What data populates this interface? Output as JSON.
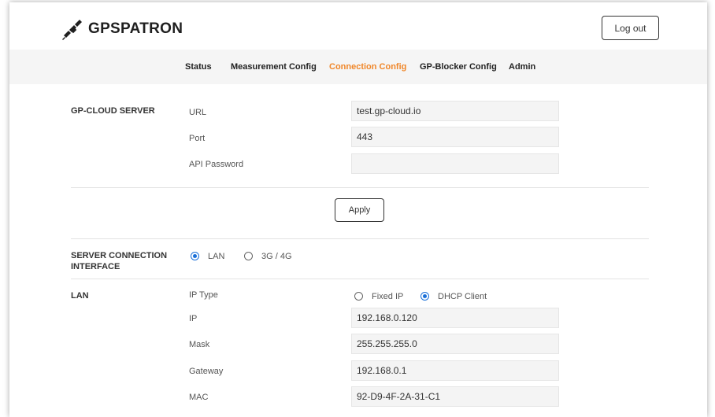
{
  "header": {
    "brand": "GPSPATRON",
    "logout_label": "Log out"
  },
  "nav": {
    "items": [
      {
        "label": "Status"
      },
      {
        "label": "Measurement Config"
      },
      {
        "label": "Connection Config",
        "active": true
      },
      {
        "label": "GP-Blocker Config"
      },
      {
        "label": "Admin"
      }
    ]
  },
  "gp_cloud": {
    "title": "GP-CLOUD SERVER",
    "url_label": "URL",
    "url_value": "test.gp-cloud.io",
    "port_label": "Port",
    "port_value": "443",
    "password_label": "API Password",
    "password_value": "",
    "apply_label": "Apply"
  },
  "interface": {
    "title_line1": "SERVER CONNECTION",
    "title_line2": "INTERFACE",
    "options": [
      {
        "label": "LAN",
        "selected": true
      },
      {
        "label": "3G / 4G",
        "selected": false
      }
    ]
  },
  "lan": {
    "title": "LAN",
    "ip_type_label": "IP Type",
    "ip_type_options": [
      {
        "label": "Fixed IP",
        "selected": false
      },
      {
        "label": "DHCP Client",
        "selected": true
      }
    ],
    "ip_label": "IP",
    "ip_value": "192.168.0.120",
    "mask_label": "Mask",
    "mask_value": "255.255.255.0",
    "gateway_label": "Gateway",
    "gateway_value": "192.168.0.1",
    "mac_label": "MAC",
    "mac_value": "92-D9-4F-2A-31-C1"
  },
  "colors": {
    "accent_active_nav": "#f0872a",
    "radio_selected": "#1a6fd8"
  }
}
